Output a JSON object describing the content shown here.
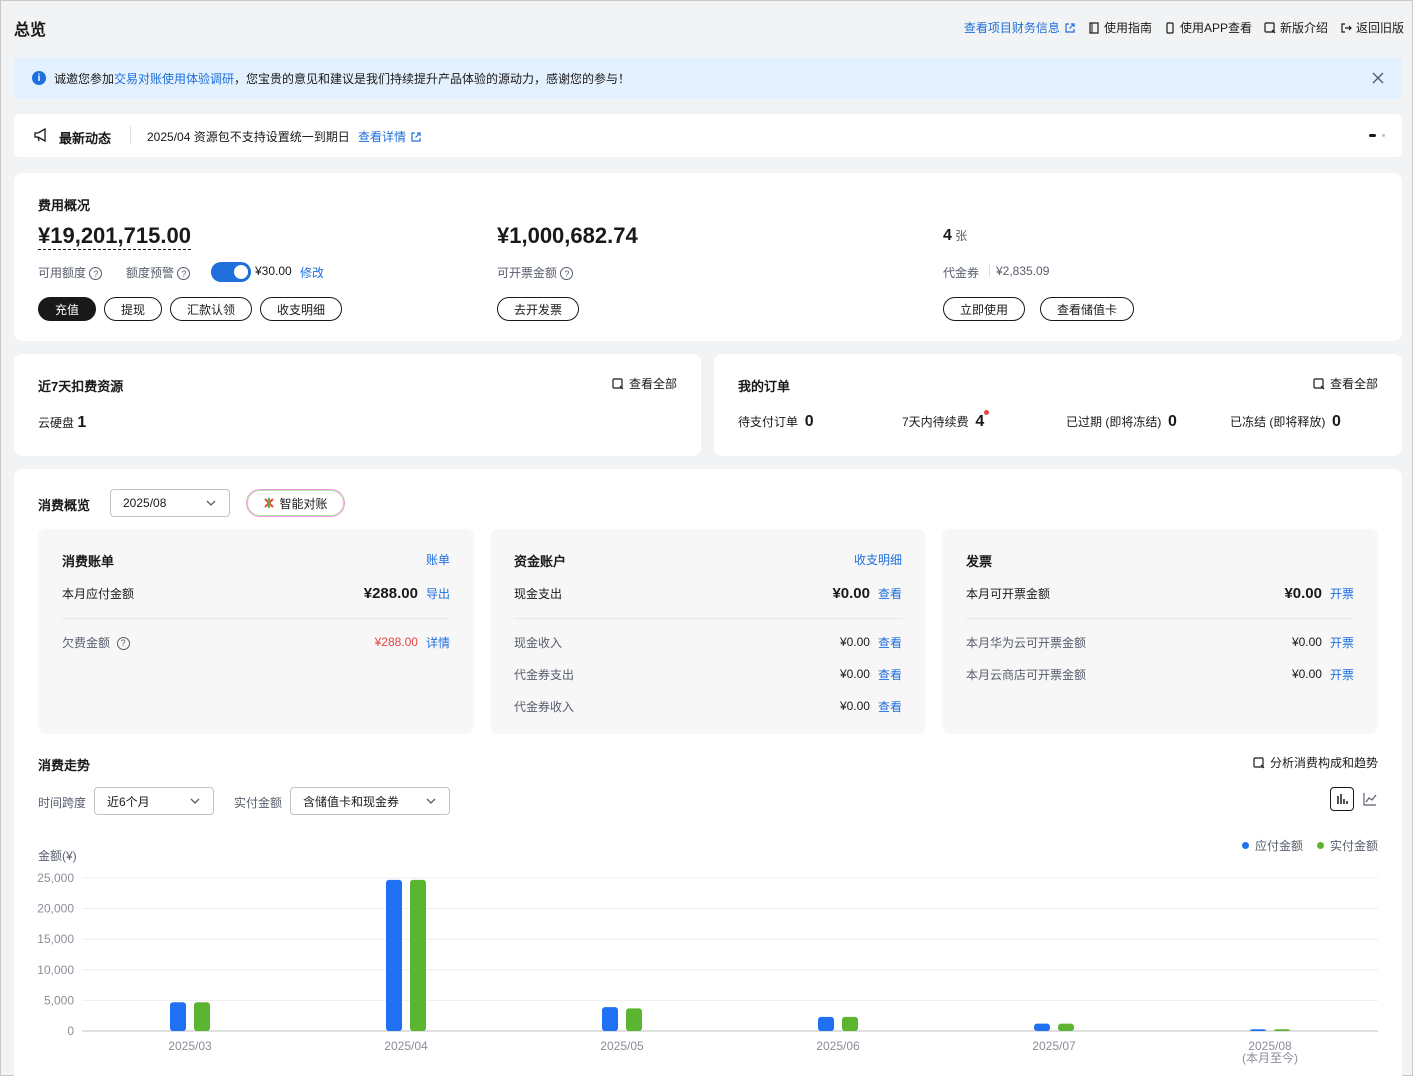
{
  "header": {
    "title": "总览",
    "links": [
      "查看项目财务信息",
      "使用指南",
      "使用APP查看",
      "新版介绍",
      "返回旧版"
    ]
  },
  "notice": {
    "prefix": "诚邀您参加",
    "link": "交易对账使用体验调研",
    "suffix": "，您宝贵的意见和建议是我们持续提升产品体验的源动力，感谢您的参与！"
  },
  "news": {
    "label": "最新动态",
    "text": "2025/04 资源包不支持设置统一到期日",
    "link": "查看详情"
  },
  "fee": {
    "title": "费用概况",
    "balance": "¥19,201,715.00",
    "balance_label": "可用额度",
    "warn_label": "额度预警",
    "warn_value": "¥30.00",
    "warn_edit": "修改",
    "buttons": [
      "充值",
      "提现",
      "汇款认领",
      "收支明细"
    ],
    "invoice_amount": "¥1,000,682.74",
    "invoice_label": "可开票金额",
    "invoice_button": "去开发票",
    "coupon_count": "4",
    "coupon_unit": "张",
    "coupon_label": "代金券",
    "coupon_value": "¥2,835.09",
    "coupon_buttons": [
      "立即使用",
      "查看储值卡"
    ]
  },
  "resources": {
    "title": "近7天扣费资源",
    "view_all": "查看全部",
    "item_label": "云硬盘",
    "item_count": "1"
  },
  "orders": {
    "title": "我的订单",
    "view_all": "查看全部",
    "items": [
      {
        "label": "待支付订单",
        "count": "0"
      },
      {
        "label": "7天内待续费",
        "count": "4"
      },
      {
        "label": "已过期 (即将冻结)",
        "count": "0"
      },
      {
        "label": "已冻结 (即将释放)",
        "count": "0"
      }
    ]
  },
  "consumption": {
    "title": "消费概览",
    "month": "2025/08",
    "smart_button": "智能对账",
    "bill": {
      "title": "消费账单",
      "link": "账单",
      "payable_label": "本月应付金额",
      "payable_value": "¥288.00",
      "payable_action": "导出",
      "arrears_label": "欠费金额",
      "arrears_value": "¥288.00",
      "arrears_action": "详情"
    },
    "funds": {
      "title": "资金账户",
      "link": "收支明细",
      "rows": [
        {
          "label": "现金支出",
          "value": "¥0.00",
          "action": "查看"
        },
        {
          "label": "现金收入",
          "value": "¥0.00",
          "action": "查看"
        },
        {
          "label": "代金券支出",
          "value": "¥0.00",
          "action": "查看"
        },
        {
          "label": "代金券收入",
          "value": "¥0.00",
          "action": "查看"
        }
      ]
    },
    "invoice": {
      "title": "发票",
      "rows": [
        {
          "label": "本月可开票金额",
          "value": "¥0.00",
          "action": "开票"
        },
        {
          "label": "本月华为云可开票金额",
          "value": "¥0.00",
          "action": "开票"
        },
        {
          "label": "本月云商店可开票金额",
          "value": "¥0.00",
          "action": "开票"
        }
      ]
    }
  },
  "trend": {
    "title": "消费走势",
    "analyze_link": "分析消费构成和趋势",
    "span_label": "时间跨度",
    "span_value": "近6个月",
    "paid_label": "实付金额",
    "paid_value": "含储值卡和现金券"
  },
  "colors": {
    "payable": "#2070f3",
    "paid": "#5cb531",
    "accent": "#1e6fdc",
    "danger": "#e54545"
  },
  "chart_data": {
    "type": "bar",
    "ylabel": "金额(¥)",
    "ylim": [
      0,
      25000
    ],
    "yticks": [
      "25,000",
      "20,000",
      "15,000",
      "10,000",
      "5,000",
      "0"
    ],
    "categories": [
      "2025/03",
      "2025/04",
      "2025/05",
      "2025/06",
      "2025/07",
      "2025/08"
    ],
    "category_sublabels": [
      "",
      "",
      "",
      "",
      "",
      "(本月至今)"
    ],
    "series": [
      {
        "name": "应付金额",
        "values": [
          4700,
          24700,
          3900,
          2300,
          1200,
          288
        ]
      },
      {
        "name": "实付金额",
        "values": [
          4700,
          24700,
          3700,
          2300,
          1200,
          288
        ]
      }
    ],
    "legend": "top-right",
    "grid": true
  }
}
